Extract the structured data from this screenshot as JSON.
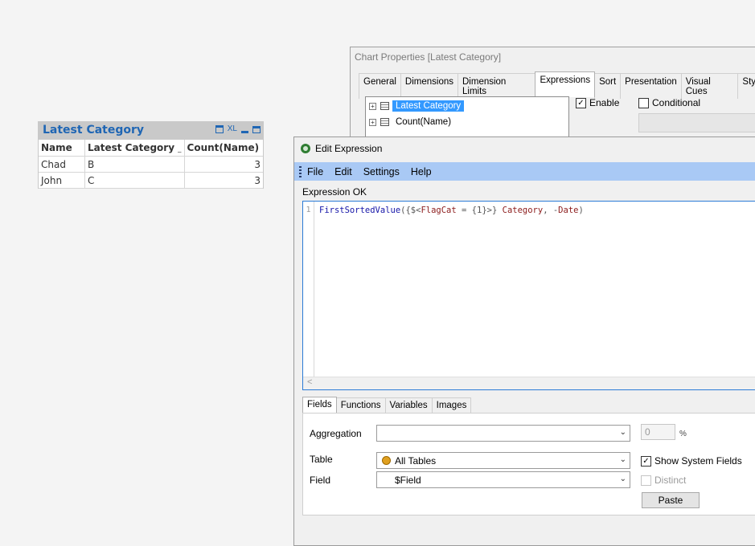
{
  "table_box": {
    "title": "Latest Category",
    "caption_icons": [
      "print-icon",
      "xl-icon",
      "minimize-icon",
      "maximize-icon"
    ],
    "xl_label": "XL",
    "columns": [
      "Name",
      "Latest Category",
      "Count(Name)"
    ],
    "rows": [
      [
        "Chad",
        "B",
        "3"
      ],
      [
        "John",
        "C",
        "3"
      ]
    ]
  },
  "chart_properties": {
    "title": "Chart Properties [Latest Category]",
    "tabs": [
      "General",
      "Dimensions",
      "Dimension Limits",
      "Expressions",
      "Sort",
      "Presentation",
      "Visual Cues",
      "Style"
    ],
    "active_tab": "Expressions",
    "expressions": [
      "Latest Category",
      "Count(Name)"
    ],
    "enable_label": "Enable",
    "enable_checked": true,
    "conditional_label": "Conditional",
    "conditional_checked": false
  },
  "edit_expression": {
    "title": "Edit Expression",
    "menu": [
      "File",
      "Edit",
      "Settings",
      "Help"
    ],
    "status": "Expression OK",
    "line_number": "1",
    "code": "FirstSortedValue({$<FlagCat = {1}>} Category, -Date)",
    "code_parts": {
      "fn": "FirstSortedValue",
      "open": "({$<",
      "field1": "FlagCat",
      "mid": " = {1}>} ",
      "field2": "Category",
      "comma": ", -",
      "field3": "Date",
      "close": ")"
    },
    "scroll_left": "<",
    "tabs": [
      "Fields",
      "Functions",
      "Variables",
      "Images"
    ],
    "active_tab": "Fields",
    "aggregation_label": "Aggregation",
    "aggregation_value": "",
    "percent_value": "0",
    "percent_sign": "%",
    "table_label": "Table",
    "table_value": "All Tables",
    "field_label": "Field",
    "field_value": "$Field",
    "show_system_fields_label": "Show System Fields",
    "show_system_fields_checked": true,
    "distinct_label": "Distinct",
    "paste_label": "Paste"
  },
  "colors": {
    "accent": "#1f66b4",
    "menu_bar": "#a9c9f5",
    "selection": "#3399ff"
  }
}
